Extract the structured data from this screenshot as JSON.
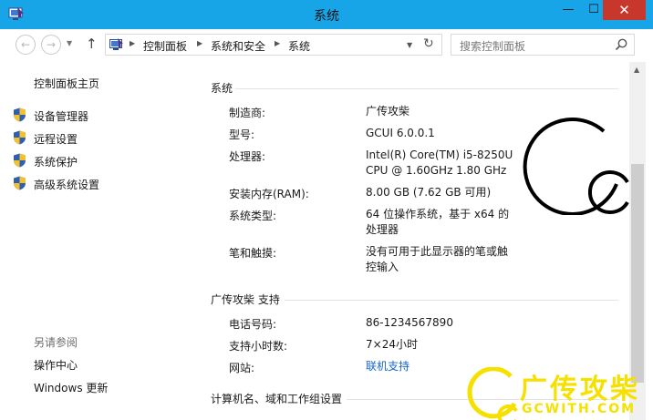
{
  "window": {
    "title": "系统",
    "minimize_glyph": "—",
    "maximize_glyph": "☐",
    "close_glyph": "✕"
  },
  "navbar": {
    "back_glyph": "←",
    "forward_glyph": "→",
    "up_glyph": "↑",
    "breadcrumbs": [
      "控制面板",
      "系统和安全",
      "系统"
    ],
    "breadcrumb_sep": "▶",
    "refresh_glyph": "↻",
    "search_placeholder": "搜索控制面板"
  },
  "sidebar": {
    "home": "控制面板主页",
    "tasks": [
      "设备管理器",
      "远程设置",
      "系统保护",
      "高级系统设置"
    ],
    "see_also_header": "另请参阅",
    "see_also": [
      "操作中心",
      "Windows 更新"
    ]
  },
  "system": {
    "section_title": "系统",
    "rows": [
      {
        "label": "制造商:",
        "value": "广传攻柴"
      },
      {
        "label": "型号:",
        "value": "GCUI 6.0.0.1"
      },
      {
        "label": "处理器:",
        "value": [
          "Intel(R) Core(TM) i5-8250U",
          "CPU @ 1.60GHz   1.80 GHz"
        ]
      },
      {
        "label": "安装内存(RAM):",
        "value": "8.00 GB (7.62 GB 可用)"
      },
      {
        "label": "系统类型:",
        "value": [
          "64 位操作系统，基于 x64 的",
          "处理器"
        ]
      },
      {
        "label": "笔和触摸:",
        "value": [
          "没有可用于此显示器的笔或触",
          "控输入"
        ]
      }
    ]
  },
  "support": {
    "section_title": "广传攻柴 支持",
    "rows": [
      {
        "label": "电话号码:",
        "value": "86-1234567890"
      },
      {
        "label": "支持小时数:",
        "value": "7×24小时"
      },
      {
        "label": "网站:",
        "value": "联机支持"
      }
    ]
  },
  "computer_section": {
    "section_title": "计算机名、域和工作组设置"
  },
  "watermark": {
    "cn": "广传攻柴",
    "en": "GCWITH.COM"
  },
  "colors": {
    "titlebar": "#18a5e8",
    "close": "#c7372c",
    "link": "#1766c8",
    "watermark": "#f5e000"
  },
  "icons": [
    "app-icon",
    "back-arrow-icon",
    "forward-arrow-icon",
    "up-arrow-icon",
    "control-panel-icon",
    "refresh-icon",
    "search-icon",
    "uac-shield-icon",
    "logo-ring-icon"
  ]
}
